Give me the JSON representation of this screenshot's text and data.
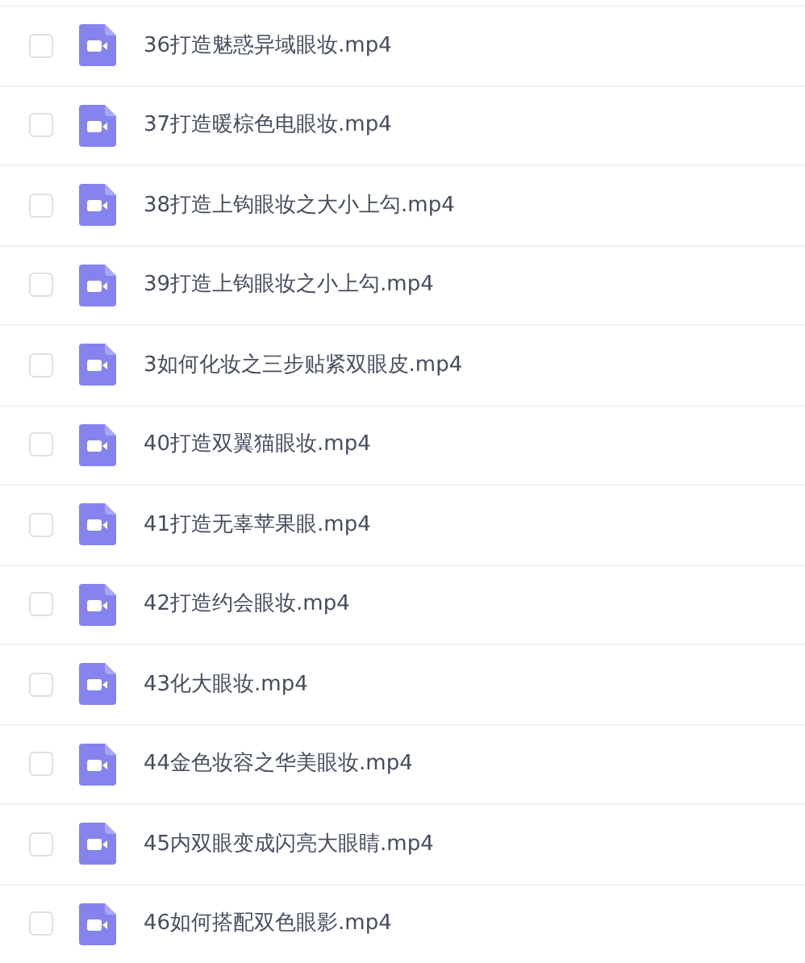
{
  "files": [
    {
      "name": "36打造魅惑异域眼妆.mp4",
      "checked": false
    },
    {
      "name": "37打造暖棕色电眼妆.mp4",
      "checked": false
    },
    {
      "name": "38打造上钩眼妆之大小上勾.mp4",
      "checked": false
    },
    {
      "name": "39打造上钩眼妆之小上勾.mp4",
      "checked": false
    },
    {
      "name": "3如何化妆之三步贴紧双眼皮.mp4",
      "checked": false
    },
    {
      "name": "40打造双翼猫眼妆.mp4",
      "checked": false
    },
    {
      "name": "41打造无辜苹果眼.mp4",
      "checked": false
    },
    {
      "name": "42打造约会眼妆.mp4",
      "checked": false
    },
    {
      "name": "43化大眼妆.mp4",
      "checked": false
    },
    {
      "name": "44金色妆容之华美眼妆.mp4",
      "checked": false
    },
    {
      "name": "45内双眼变成闪亮大眼睛.mp4",
      "checked": false
    },
    {
      "name": "46如何搭配双色眼影.mp4",
      "checked": false
    }
  ]
}
